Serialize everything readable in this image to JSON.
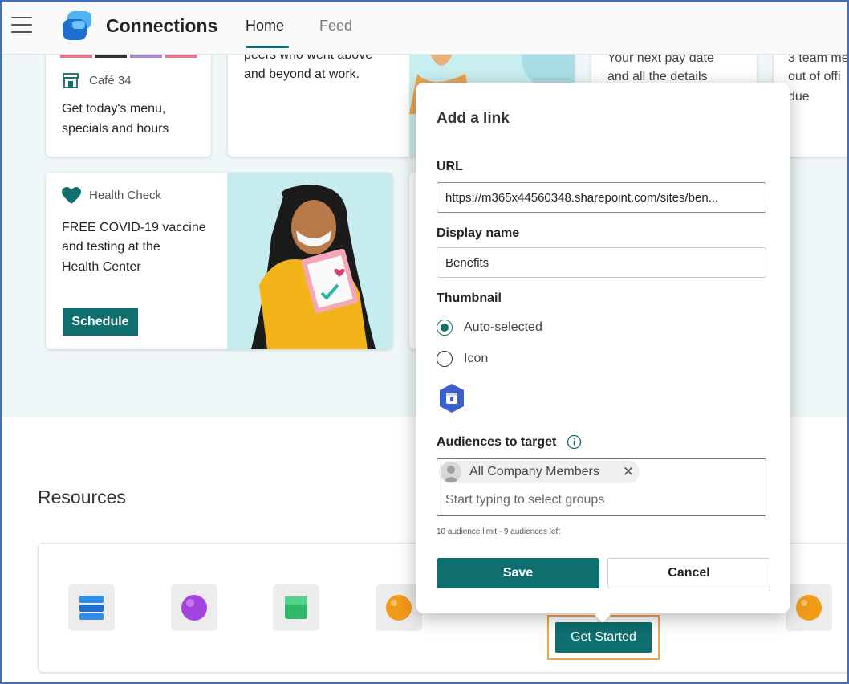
{
  "header": {
    "app_title": "Connections",
    "tabs": [
      {
        "label": "Home",
        "active": true
      },
      {
        "label": "Feed",
        "active": false
      }
    ]
  },
  "cards": {
    "cafe": {
      "label": "Café 34",
      "text_line1": "Get today's menu,",
      "text_line2": "specials and hours"
    },
    "recognition": {
      "text_line1": "peers who went above",
      "text_line2": "and beyond at work."
    },
    "payday": {
      "text_line1": "Your next pay date",
      "text_line2": "and all the details"
    },
    "out_of_office": {
      "text_line1": "3 team me",
      "text_line2": "out of offi",
      "text_line3": "due"
    },
    "health": {
      "label": "Health Check",
      "text_line1": "FREE COVID-19 vaccine",
      "text_line2": "and testing at the",
      "text_line3": "Health Center",
      "button": "Schedule"
    }
  },
  "resources": {
    "title": "Resources",
    "get_started_label": "Get Started"
  },
  "dialog": {
    "title": "Add a link",
    "url_label": "URL",
    "url_value": "https://m365x44560348.sharepoint.com/sites/ben...",
    "display_name_label": "Display name",
    "display_name_value": "Benefits",
    "thumbnail_label": "Thumbnail",
    "thumbnail_options": [
      {
        "label": "Auto-selected",
        "checked": true
      },
      {
        "label": "Icon",
        "checked": false
      }
    ],
    "audiences_label": "Audiences to target",
    "audience_chip": "All Company Members",
    "audience_placeholder": "Start typing to select groups",
    "audience_hint": "10 audience limit - 9 audiences left",
    "save_label": "Save",
    "cancel_label": "Cancel"
  },
  "colors": {
    "accent": "#0f6e6e",
    "highlight_outline": "#f1a34a",
    "frame_border": "#3f6fc4"
  }
}
